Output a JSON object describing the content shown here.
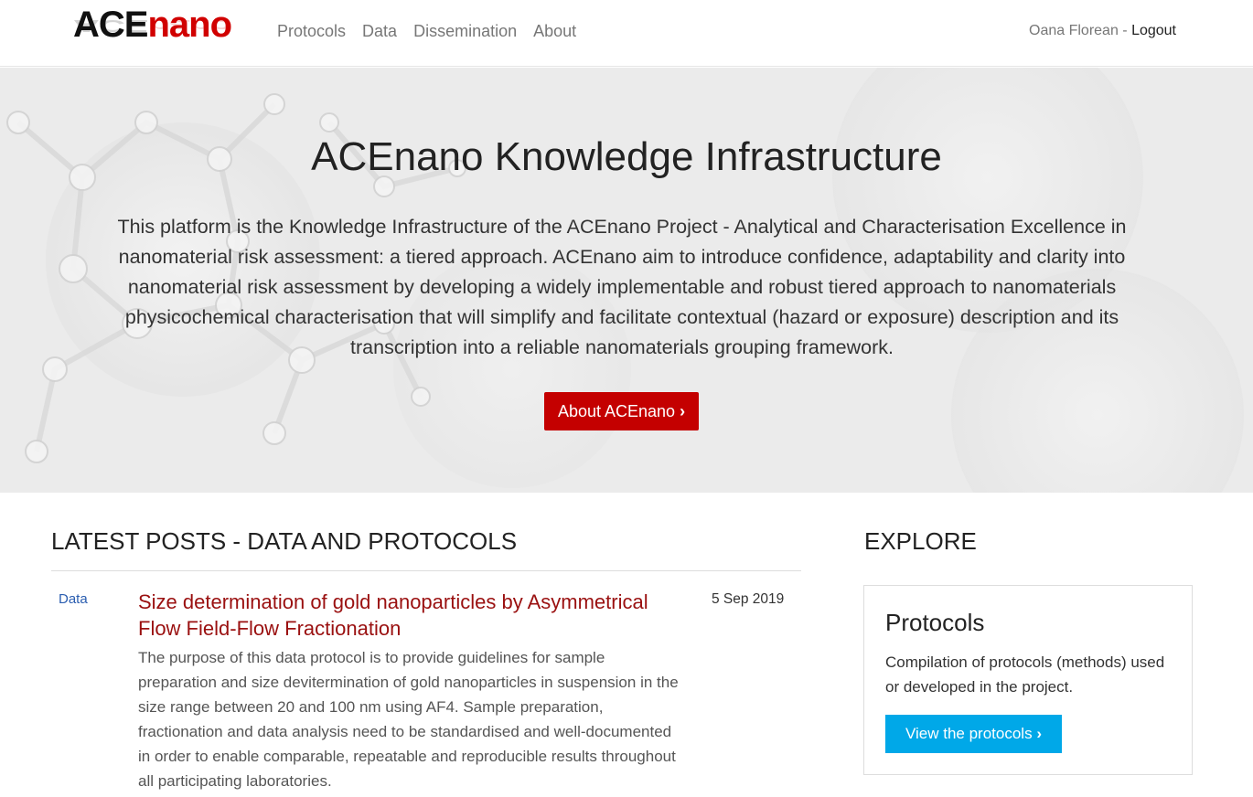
{
  "brand": {
    "logo_ace": "ACE",
    "logo_nano": "nano",
    "accent_red": "#c40000",
    "accent_blue": "#00a8e8"
  },
  "nav": {
    "links": [
      "Protocols",
      "Data",
      "Dissemination",
      "About"
    ],
    "user_name": "Oana Florean",
    "separator": " - ",
    "logout_label": "Logout"
  },
  "hero": {
    "title": "ACEnano Knowledge Infrastructure",
    "description": "This platform is the Knowledge Infrastructure of the ACEnano Project - Analytical and Characterisation Excellence in nanomaterial risk assessment: a tiered approach. ACEnano aim to introduce confidence, adaptability and clarity into nanomaterial risk assessment by developing a widely implementable and robust tiered approach to nanomaterials physicochemical characterisation that will simplify and facilitate contextual (hazard or exposure) description and its transcription into a reliable nanomaterials grouping framework.",
    "button_label": "About ACEnano",
    "button_icon": "chevron-right-icon"
  },
  "latest": {
    "heading": "LATEST POSTS - DATA AND PROTOCOLS",
    "posts": [
      {
        "tag": "Data",
        "title": "Size determination of gold nanoparticles by Asymmetrical Flow Field-Flow Fractionation",
        "date": "5 Sep 2019",
        "excerpt": "The purpose of this data protocol is to provide guidelines for sample preparation and size devitermination of gold nanoparticles in suspension in the size range between 20 and 100 nm using AF4. Sample preparation, fractionation and data analysis need to be standardised and well-documented in order to enable comparable, repeatable and reproducible results throughout all participating laboratories."
      }
    ]
  },
  "explore": {
    "heading": "EXPLORE",
    "card": {
      "title": "Protocols",
      "description": "Compilation of protocols (methods) used or developed in the project.",
      "button_label": "View the protocols",
      "button_icon": "chevron-right-icon"
    }
  }
}
